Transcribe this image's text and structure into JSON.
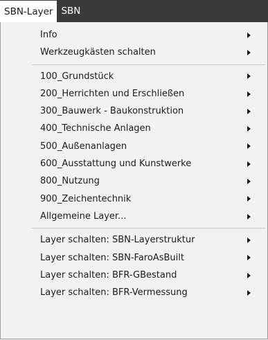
{
  "menubar": {
    "items": [
      {
        "label": "SBN-Layer",
        "active": true
      },
      {
        "label": "SBN",
        "active": false
      }
    ]
  },
  "dropdown": {
    "groups": [
      [
        {
          "label": "Info",
          "submenu_icon": "chevron-right-icon"
        },
        {
          "label": "Werkzeugkästen schalten",
          "submenu_icon": "chevron-right-icon"
        }
      ],
      [
        {
          "label": "100_Grundstück",
          "submenu_icon": "chevron-right-icon"
        },
        {
          "label": "200_Herrichten und Erschließen",
          "submenu_icon": "chevron-right-icon"
        },
        {
          "label": "300_Bauwerk - Baukonstruktion",
          "submenu_icon": "chevron-right-icon"
        },
        {
          "label": "400_Technische Anlagen",
          "submenu_icon": "chevron-right-icon"
        },
        {
          "label": "500_Außenanlagen",
          "submenu_icon": "chevron-right-icon"
        },
        {
          "label": "600_Ausstattung und Kunstwerke",
          "submenu_icon": "chevron-right-icon"
        },
        {
          "label": "800_Nutzung",
          "submenu_icon": "chevron-right-icon"
        },
        {
          "label": "900_Zeichentechnik",
          "submenu_icon": "chevron-right-icon"
        },
        {
          "label": "Allgemeine Layer...",
          "submenu_icon": "chevron-right-icon"
        }
      ],
      [
        {
          "label": "Layer schalten: SBN-Layerstruktur",
          "submenu_icon": "chevron-right-icon"
        },
        {
          "label": "Layer schalten: SBN-FaroAsBuilt",
          "submenu_icon": "chevron-right-icon"
        },
        {
          "label": "Layer schalten: BFR-GBestand",
          "submenu_icon": "chevron-right-icon"
        },
        {
          "label": "Layer schalten: BFR-Vermessung",
          "submenu_icon": "chevron-right-icon"
        }
      ]
    ]
  },
  "colors": {
    "menubar_bg": "#3a3a3a",
    "menubar_text": "#ffffff",
    "active_bg": "#ffffff",
    "dropdown_bg": "#f2f2f2",
    "text": "#1b1b1b",
    "separator": "#c8c8c8"
  }
}
